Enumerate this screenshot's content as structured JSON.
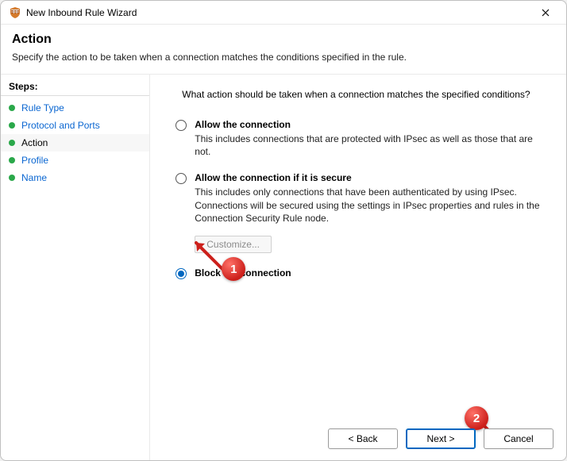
{
  "titlebar": {
    "title": "New Inbound Rule Wizard",
    "icon": "firewall-shield"
  },
  "header": {
    "title": "Action",
    "subtitle": "Specify the action to be taken when a connection matches the conditions specified in the rule."
  },
  "steps": {
    "heading": "Steps:",
    "items": [
      {
        "label": "Rule Type",
        "current": false
      },
      {
        "label": "Protocol and Ports",
        "current": false
      },
      {
        "label": "Action",
        "current": true
      },
      {
        "label": "Profile",
        "current": false
      },
      {
        "label": "Name",
        "current": false
      }
    ]
  },
  "main": {
    "prompt": "What action should be taken when a connection matches the specified conditions?",
    "options": [
      {
        "id": "allow",
        "label": "Allow the connection",
        "desc": "This includes connections that are protected with IPsec as well as those that are not.",
        "selected": false
      },
      {
        "id": "allow-secure",
        "label": "Allow the connection if it is secure",
        "desc": "This includes only connections that have been authenticated by using IPsec.  Connections will be secured using the settings in IPsec properties and rules in the Connection Security Rule node.",
        "selected": false
      },
      {
        "id": "block",
        "label": "Block the connection",
        "desc": "",
        "selected": true
      }
    ],
    "customize_label": "Customize...",
    "customize_enabled": false
  },
  "buttons": {
    "back": "< Back",
    "next": "Next >",
    "cancel": "Cancel"
  },
  "annotations": {
    "callout1": "1",
    "callout2": "2"
  }
}
